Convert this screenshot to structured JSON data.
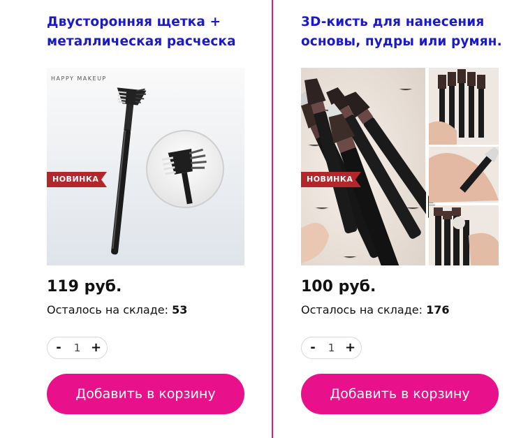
{
  "products": [
    {
      "title_line1": "Двусторонняя щетка +",
      "title_line2": "металлическая расческа",
      "brand_text": "HAPPY MAKEUP",
      "badge": "НОВИНКА",
      "price": "119 руб.",
      "stock_label": "Осталось на складе:",
      "stock_value": "53",
      "minus": "-",
      "quantity": "1",
      "plus": "+",
      "add_to_cart": "Добавить в корзину"
    },
    {
      "title_line1": "3D-кисть для нанесения",
      "title_line2": "основы, пудры или румян.",
      "badge": "НОВИНКА",
      "price": "100 руб.",
      "stock_label": "Осталось на складе:",
      "stock_value": "176",
      "minus": "-",
      "quantity": "1",
      "plus": "+",
      "add_to_cart": "Добавить в корзину"
    }
  ],
  "colors": {
    "title": "#1a1ac8",
    "button": "#e8118b",
    "divider": "#d61f7a",
    "badge": "#b3262b"
  }
}
